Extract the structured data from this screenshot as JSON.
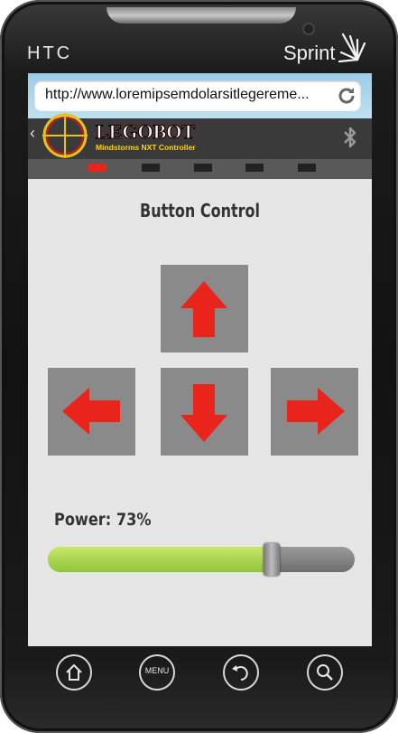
{
  "device": {
    "brand_left": "HTC",
    "carrier": "Sprint"
  },
  "browser": {
    "url": "http://www.loremipsemdolarsitlegereme..."
  },
  "app": {
    "logo_title": "LEGOBOT",
    "logo_subtitle": "Mindstorms NXT Controller",
    "pager": {
      "count": 5,
      "active_index": 0
    },
    "screen_title": "Button Control",
    "controls": [
      "up-arrow-icon",
      "left-arrow-icon",
      "down-arrow-icon",
      "right-arrow-icon"
    ],
    "power_label": "Power: 73%",
    "power_value": 0.73
  },
  "nav": {
    "menu_label": "MENU",
    "icons": [
      "home-icon",
      "menu-icon",
      "back-icon",
      "search-icon"
    ]
  },
  "colors": {
    "accent": "#e8241b",
    "slider_fill": "#9fd046",
    "button_bg": "#8a8a8a",
    "screen_bg": "#e6e6e6"
  }
}
